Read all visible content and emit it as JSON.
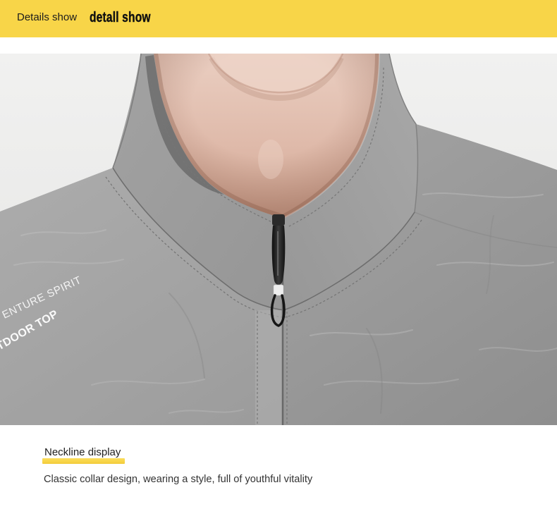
{
  "colors": {
    "accent": "#F8D548"
  },
  "header": {
    "title": "Details show",
    "subtitle": "detall show"
  },
  "photo": {
    "print_line_1": "ENTURE SPIRIT",
    "print_line_2": "TDOOR TOP"
  },
  "caption": {
    "title": "Neckline display",
    "description": "Classic collar design, wearing a style, full of youthful vitality"
  }
}
